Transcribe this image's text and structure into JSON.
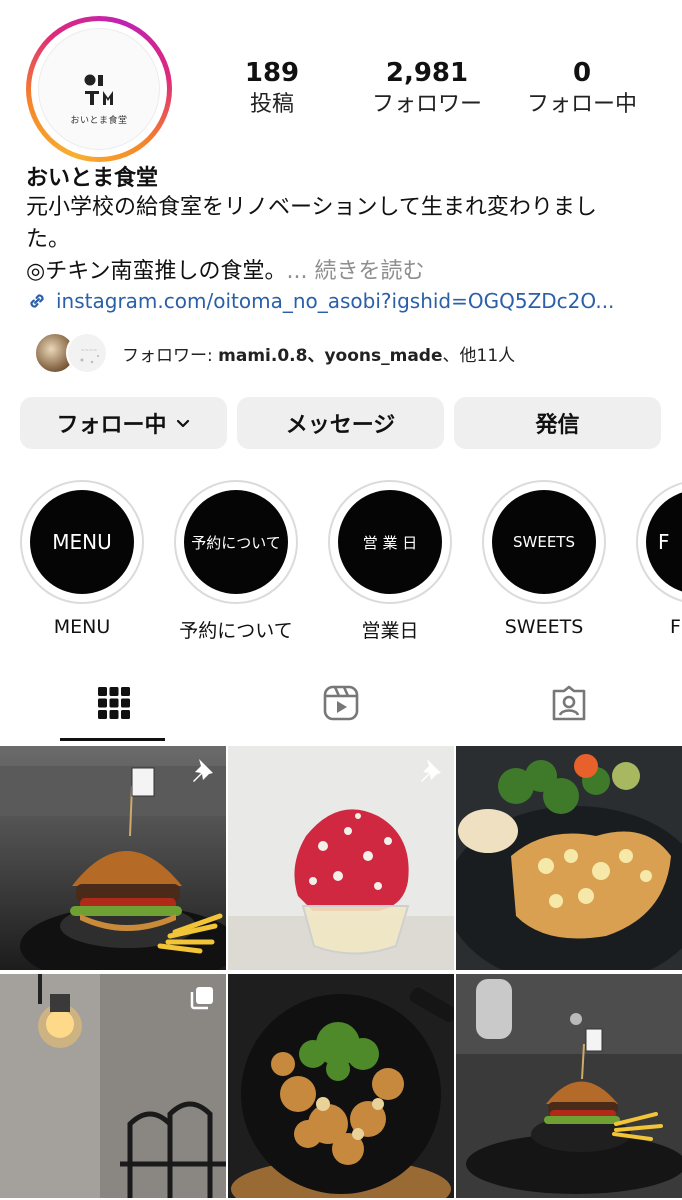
{
  "profile": {
    "logo_text": "おいとま食堂",
    "name": "おいとま食堂",
    "bio_line1": "元小学校の給食室をリノベーションして生まれ変わりまし",
    "bio_line2": "た。",
    "bio_line3": "◎チキン南蛮推しの食堂。",
    "bio_more": "... 続きを読む",
    "link": "instagram.com/oitoma_no_asobi?igshid=OGQ5ZDc2O...",
    "link_icon": "link-icon"
  },
  "stats": {
    "posts": {
      "value": "189",
      "label": "投稿"
    },
    "followers": {
      "value": "2,981",
      "label": "フォロワー"
    },
    "following": {
      "value": "0",
      "label": "フォロー中"
    }
  },
  "followed_by": {
    "prefix": "フォロワー: ",
    "names": "mami.0.8、yoons_made",
    "suffix": "、他11人"
  },
  "actions": {
    "follow": "フォロー中",
    "follow_chevron": "⌄",
    "message": "メッセージ",
    "share": "発信"
  },
  "highlights": [
    {
      "cover": "MENU",
      "label": "MENU"
    },
    {
      "cover": "予約について",
      "label": "予約について"
    },
    {
      "cover": "営 業 日",
      "label": "営業日"
    },
    {
      "cover": "SWEETS",
      "label": "SWEETS"
    },
    {
      "cover": "F",
      "label": "F"
    }
  ],
  "tabs": [
    {
      "name": "grid",
      "icon": "grid-icon",
      "active": true
    },
    {
      "name": "reels",
      "icon": "reels-icon",
      "active": false
    },
    {
      "name": "tagged",
      "icon": "tagged-icon",
      "active": false
    }
  ],
  "colors": {
    "link": "#2b5fa8",
    "button_bg": "#efefef",
    "highlight_disc": "#050505"
  }
}
